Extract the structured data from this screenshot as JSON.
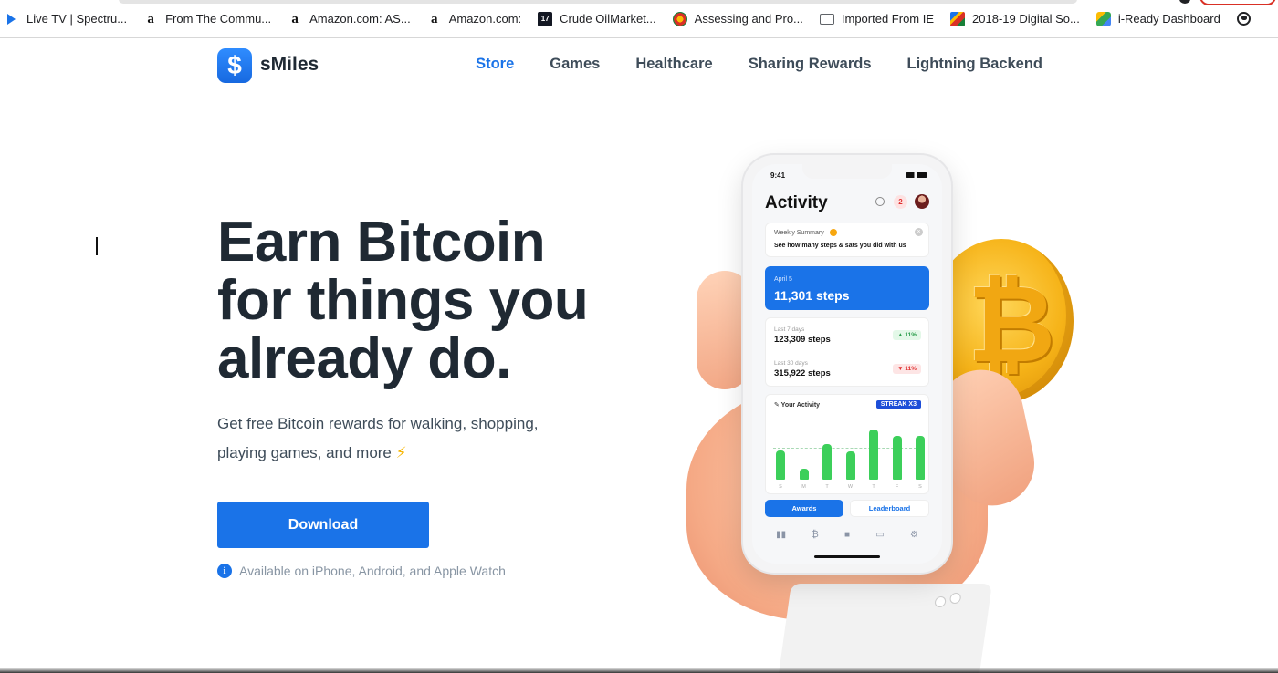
{
  "bookmarks": [
    {
      "label": "Live TV | Spectru...",
      "icon": "play-icon"
    },
    {
      "label": "From The Commu...",
      "icon": "amazon-icon"
    },
    {
      "label": "Amazon.com: AS...",
      "icon": "amazon-icon"
    },
    {
      "label": "Amazon.com:",
      "icon": "amazon-icon"
    },
    {
      "label": "Crude OilMarket...",
      "icon": "tradingview-icon"
    },
    {
      "label": "Assessing and Pro...",
      "icon": "flower-icon"
    },
    {
      "label": "Imported From IE",
      "icon": "folder-icon"
    },
    {
      "label": "2018-19 Digital So...",
      "icon": "flag-icon"
    },
    {
      "label": "i-Ready Dashboard",
      "icon": "cube-icon"
    }
  ],
  "logo_glyph": "$",
  "brand": "sMiles",
  "nav": {
    "items": [
      "Store",
      "Games",
      "Healthcare",
      "Sharing Rewards",
      "Lightning Backend"
    ],
    "active": "Store"
  },
  "hero": {
    "headline": "Earn Bitcoin for things you already do.",
    "subtext": "Get free Bitcoin rewards for walking, shopping, playing games, and more",
    "bolt": "⚡",
    "download_label": "Download",
    "availability": "Available on iPhone, Android, and Apple Watch",
    "info_glyph": "i"
  },
  "phone": {
    "time": "9:41",
    "title": "Activity",
    "notification_count": "2",
    "weekly_title": "Weekly Summary",
    "weekly_text": "See how many steps & sats you did with us",
    "date": "April 5",
    "steps_today": "11,301 steps",
    "last7_label": "Last 7 days",
    "last7_value": "123,309 steps",
    "last7_change": "▲ 11%",
    "last30_label": "Last 30 days",
    "last30_value": "315,922 steps",
    "last30_change": "▼ 11%",
    "activity_title": "✎ Your Activity",
    "streak": "STREAK X3",
    "days": [
      "S",
      "M",
      "T",
      "W",
      "T",
      "F",
      "S"
    ],
    "bar_levels": [
      0.52,
      0.2,
      0.63,
      0.5,
      0.88,
      0.77,
      0.77
    ],
    "awards_label": "Awards",
    "leaderboard_label": "Leaderboard",
    "tab_icons": [
      "chart-icon",
      "bitcoin-icon",
      "lock-icon",
      "card-icon",
      "gear-icon"
    ],
    "bitcoin_glyph": "₿"
  }
}
